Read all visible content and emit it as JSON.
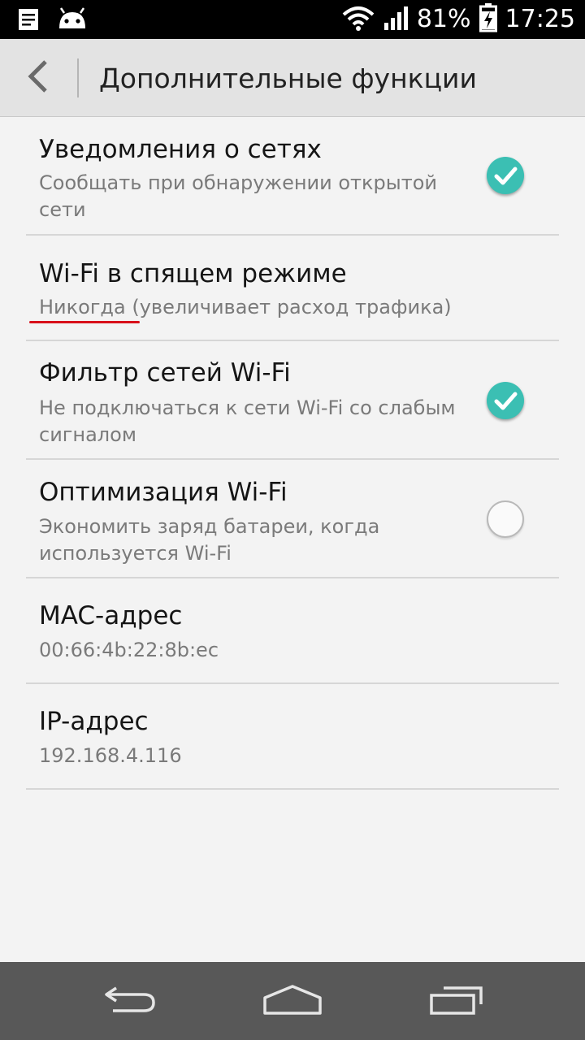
{
  "status_bar": {
    "battery": "81%",
    "time": "17:25",
    "icons": [
      "notes-icon",
      "android-icon",
      "wifi-icon",
      "signal-icon",
      "battery-charging-icon"
    ]
  },
  "action_bar": {
    "title": "Дополнительные функции"
  },
  "items": [
    {
      "title": "Уведомления о сетях",
      "subtitle": "Сообщать при обнаружении открытой сети",
      "checked": true
    },
    {
      "title": "Wi-Fi в спящем режиме",
      "subtitle": "Никогда (увеличивает расход трафика)"
    },
    {
      "title": "Фильтр сетей Wi-Fi",
      "subtitle": "Не подключаться к сети Wi-Fi со слабым сигналом",
      "checked": true
    },
    {
      "title": "Оптимизация Wi-Fi",
      "subtitle": "Экономить заряд батареи, когда используется Wi-Fi",
      "checked": false
    },
    {
      "title": "MAC-адрес",
      "subtitle": "00:66:4b:22:8b:ec"
    },
    {
      "title": "IP-адрес",
      "subtitle": "192.168.4.116"
    }
  ],
  "colors": {
    "accent": "#3bbfb3",
    "underline": "#d8101a",
    "nav_bar": "#585858"
  }
}
